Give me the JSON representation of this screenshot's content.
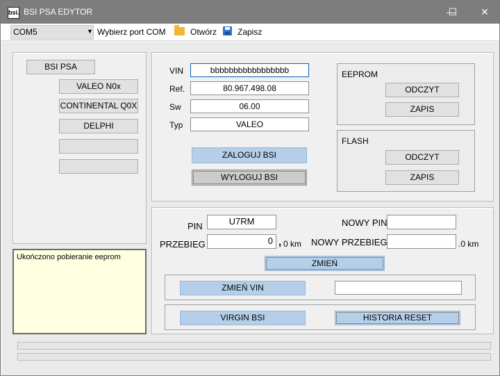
{
  "window": {
    "title": "BSI PSA EDYTOR",
    "icon_text": "bsi.",
    "minimize": "—",
    "maximize": "☐",
    "close": "✕"
  },
  "toolbar": {
    "port_value": "COM5",
    "port_label": "Wybierz port COM",
    "open_label": "Otwórz",
    "save_label": "Zapisz"
  },
  "left_panel": {
    "title_button": "BSI PSA",
    "buttons": [
      "VALEO N0x",
      "CONTINENTAL Q0X",
      "DELPHI",
      "",
      ""
    ]
  },
  "log_text": "Ukończono pobieranie eeprom",
  "info": {
    "vin_label": "VIN",
    "vin_value": "bbbbbbbbbbbbbbbbb",
    "ref_label": "Ref.",
    "ref_value": "80.967.498.08",
    "sw_label": "Sw",
    "sw_value": "06.00",
    "typ_label": "Typ",
    "typ_value": "VALEO",
    "login_button": "ZALOGUJ  BSI",
    "logout_button": "WYLOGUJ BSI"
  },
  "eeprom": {
    "title": "EEPROM",
    "read": "ODCZYT",
    "write": "ZAPIS"
  },
  "flash": {
    "title": "FLASH",
    "read": "ODCZYT",
    "write": "ZAPIS"
  },
  "edit": {
    "pin_label": "PIN",
    "pin_value": "U7RM",
    "new_pin_label": "NOWY PIN",
    "new_pin_value": "",
    "mileage_label": "PRZEBIEG",
    "mileage_value": "0",
    "mileage_suffix_dot": ",",
    "mileage_suffix": "0 km",
    "new_mileage_label": "NOWY PRZEBIEG",
    "new_mileage_value": "",
    "new_mileage_suffix": ".0 km",
    "change_button": "ZMIEŃ",
    "change_vin_button": "ZMIEŃ VIN",
    "new_vin_value": "",
    "virgin_button": "VIRGIN BSI",
    "history_button": "HISTORIA RESET"
  }
}
